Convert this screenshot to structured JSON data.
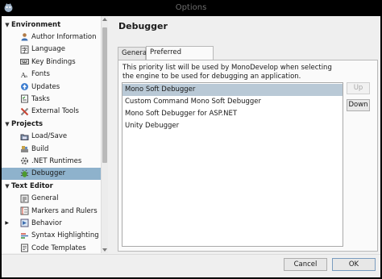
{
  "window": {
    "title": "Options"
  },
  "sidebar": {
    "items": [
      {
        "label": "Environment",
        "type": "category",
        "expanded": true,
        "icon": "expand-arrow"
      },
      {
        "label": "Author Information",
        "type": "item",
        "icon": "person-icon"
      },
      {
        "label": "Language",
        "type": "item",
        "icon": "language-icon"
      },
      {
        "label": "Key Bindings",
        "type": "item",
        "icon": "keyboard-icon"
      },
      {
        "label": "Fonts",
        "type": "item",
        "icon": "font-icon"
      },
      {
        "label": "Updates",
        "type": "item",
        "icon": "updates-icon"
      },
      {
        "label": "Tasks",
        "type": "item",
        "icon": "tasks-icon"
      },
      {
        "label": "External Tools",
        "type": "item",
        "icon": "tools-icon"
      },
      {
        "label": "Projects",
        "type": "category",
        "expanded": true,
        "icon": "expand-arrow"
      },
      {
        "label": "Load/Save",
        "type": "item",
        "icon": "load-save-icon"
      },
      {
        "label": "Build",
        "type": "item",
        "icon": "build-icon"
      },
      {
        "label": ".NET Runtimes",
        "type": "item",
        "icon": "runtime-icon"
      },
      {
        "label": "Debugger",
        "type": "item",
        "icon": "debugger-icon",
        "selected": true
      },
      {
        "label": "Text Editor",
        "type": "category",
        "expanded": true,
        "icon": "expand-arrow"
      },
      {
        "label": "General",
        "type": "item",
        "icon": "general-icon"
      },
      {
        "label": "Markers and Rulers",
        "type": "item",
        "icon": "markers-icon"
      },
      {
        "label": "Behavior",
        "type": "item",
        "icon": "behavior-icon",
        "collapsed_children": true
      },
      {
        "label": "Syntax Highlighting",
        "type": "item",
        "icon": "syntax-icon"
      },
      {
        "label": "Code Templates",
        "type": "item",
        "icon": "templates-icon"
      }
    ]
  },
  "page": {
    "title": "Debugger",
    "tabs": [
      {
        "label": "General",
        "active": false
      },
      {
        "label": "Preferred Debuggers",
        "active": true
      }
    ],
    "description": "This priority list will be used by MonoDevelop when selecting the engine to be used for debugging an application.",
    "debuggers": [
      {
        "label": "Mono Soft Debugger",
        "selected": true
      },
      {
        "label": "Custom Command Mono Soft Debugger",
        "selected": false
      },
      {
        "label": "Mono Soft Debugger for ASP.NET",
        "selected": false
      },
      {
        "label": "Unity Debugger",
        "selected": false
      }
    ],
    "up_label": "Up",
    "down_label": "Down"
  },
  "footer": {
    "cancel_label": "Cancel",
    "ok_label": "OK"
  },
  "colors": {
    "selection": "#8eb2cc",
    "list_selection": "#b9c9d6",
    "titlebar": "#000000"
  }
}
